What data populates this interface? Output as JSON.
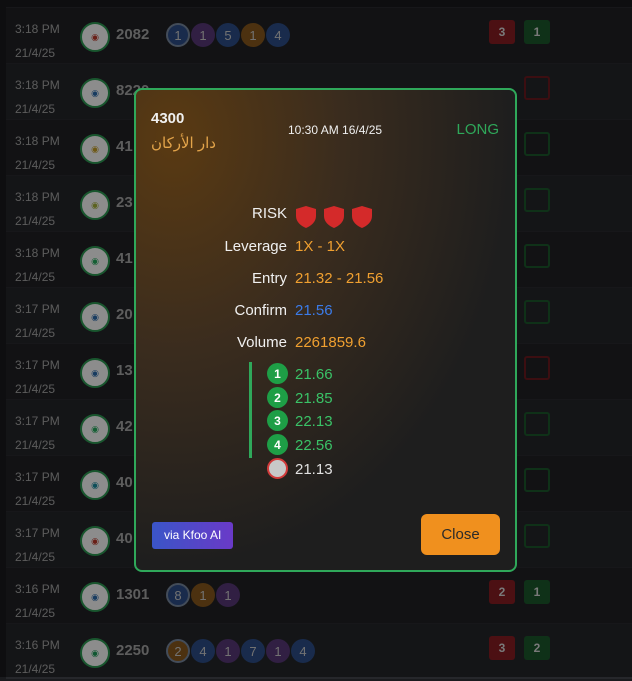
{
  "rows": [
    {
      "time": "3:18 PM",
      "date": "21/4/25",
      "code": "2082",
      "chips": [
        "1",
        "1",
        "5",
        "1",
        "4"
      ],
      "chip_colors": [
        "#2e4f8a",
        "#5a3a7a",
        "#2e4f8a",
        "#8a5a1e",
        "#2e4f8a"
      ],
      "b1": "3",
      "b2": "1"
    },
    {
      "time": "3:18 PM",
      "date": "21/4/25",
      "code": "8220"
    },
    {
      "time": "3:18 PM",
      "date": "21/4/25",
      "code": "41"
    },
    {
      "time": "3:18 PM",
      "date": "21/4/25",
      "code": "23"
    },
    {
      "time": "3:18 PM",
      "date": "21/4/25",
      "code": "41"
    },
    {
      "time": "3:17 PM",
      "date": "21/4/25",
      "code": "20"
    },
    {
      "time": "3:17 PM",
      "date": "21/4/25",
      "code": "13"
    },
    {
      "time": "3:17 PM",
      "date": "21/4/25",
      "code": "42"
    },
    {
      "time": "3:17 PM",
      "date": "21/4/25",
      "code": "40"
    },
    {
      "time": "3:17 PM",
      "date": "21/4/25",
      "code": "40"
    },
    {
      "time": "3:16 PM",
      "date": "21/4/25",
      "code": "1301",
      "chips": [
        "8",
        "1",
        "1"
      ],
      "chip_colors": [
        "#2e4f8a",
        "#8a5a1e",
        "#5a3a7a"
      ],
      "b1": "2",
      "b2": "1"
    },
    {
      "time": "3:16 PM",
      "date": "21/4/25",
      "code": "2250",
      "chips": [
        "2",
        "4",
        "1",
        "7",
        "1",
        "4"
      ],
      "chip_colors": [
        "#8a5a1e",
        "#2e4f8a",
        "#5a3a7a",
        "#2e4f8a",
        "#5a3a7a",
        "#2e4f8a"
      ],
      "b1": "3",
      "b2": "2"
    }
  ],
  "modal": {
    "symbol": "4300",
    "name": "دار الأركان",
    "datetime": "10:30 AM 16/4/25",
    "side": "LONG",
    "risk_label": "RISK",
    "risk_level": 3,
    "leverage_label": "Leverage",
    "leverage": "1X - 1X",
    "entry_label": "Entry",
    "entry": "21.32 - 21.56",
    "confirm_label": "Confirm",
    "confirm": "21.56",
    "volume_label": "Volume",
    "volume": "2261859.6",
    "targets": [
      {
        "n": "1",
        "value": "21.66"
      },
      {
        "n": "2",
        "value": "21.85"
      },
      {
        "n": "3",
        "value": "22.13"
      },
      {
        "n": "4",
        "value": "22.56"
      }
    ],
    "stop": "21.13",
    "via": "via Kfoo AI",
    "close": "Close"
  },
  "colors": {
    "accent_green": "#2fa85a",
    "accent_orange": "#f0901e",
    "risk_red": "#d42a2a"
  }
}
